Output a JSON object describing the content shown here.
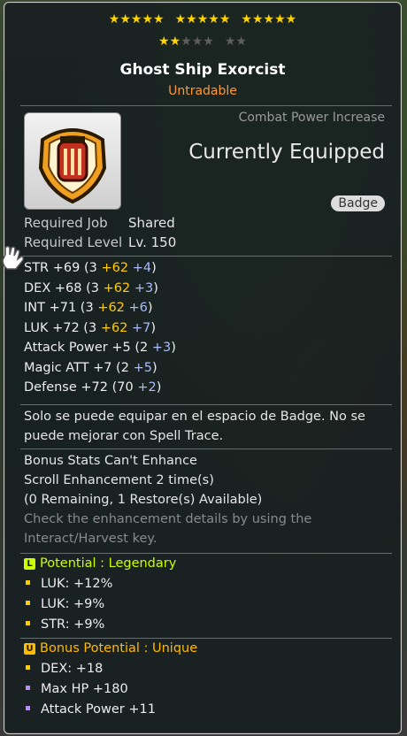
{
  "item": {
    "star_groups": [
      {
        "filled": 5,
        "total": 5
      },
      {
        "filled": 5,
        "total": 5
      },
      {
        "filled": 5,
        "total": 5
      },
      {
        "filled": 2,
        "total": 5
      },
      {
        "filled": 0,
        "total": 2
      }
    ],
    "name": "Ghost Ship Exorcist",
    "tradability": "Untradable",
    "combat_power_label": "Combat Power Increase",
    "equip_status": "Currently Equipped",
    "category": "Badge",
    "required_job_label": "Required Job",
    "required_job_value": "Shared",
    "required_level_label": "Required Level",
    "required_level_value": "Lv. 150"
  },
  "stats": [
    {
      "name": "STR",
      "total": "+69",
      "base": "3",
      "bonus": "+62",
      "enh": "+4"
    },
    {
      "name": "DEX",
      "total": "+68",
      "base": "3",
      "bonus": "+62",
      "enh": "+3"
    },
    {
      "name": "INT",
      "total": "+71",
      "base": "3",
      "bonus": "+62",
      "enh": "+6"
    },
    {
      "name": "LUK",
      "total": "+72",
      "base": "3",
      "bonus": "+62",
      "enh": "+7"
    },
    {
      "name": "Attack Power",
      "total": "+5",
      "base": "2",
      "bonus": "",
      "enh": "+3"
    },
    {
      "name": "Magic ATT",
      "total": "+7",
      "base": "2",
      "bonus": "",
      "enh": "+5"
    },
    {
      "name": "Defense",
      "total": "+72",
      "base": "70",
      "bonus": "",
      "enh": "+2"
    }
  ],
  "description": "Solo se puede equipar en el espacio de Badge. No se puede mejorar con Spell Trace.",
  "enhance_info": {
    "line1": "Bonus Stats Can't Enhance",
    "line2": "Scroll Enhancement 2 time(s)",
    "line3": "(0 Remaining, 1 Restore(s) Available)",
    "hint": "Check the enhancement details by using the Interact/Harvest key."
  },
  "potential": {
    "icon": "L",
    "title": "Potential : Legendary",
    "color": "#ccff00",
    "lines": [
      "LUK: +12%",
      "LUK: +9%",
      "STR: +9%"
    ]
  },
  "bonus_potential": {
    "icon": "U",
    "title": "Bonus Potential : Unique",
    "color": "#ffbb00",
    "lines": [
      "DEX: +18",
      "Max HP +180",
      "Attack Power +11"
    ]
  }
}
